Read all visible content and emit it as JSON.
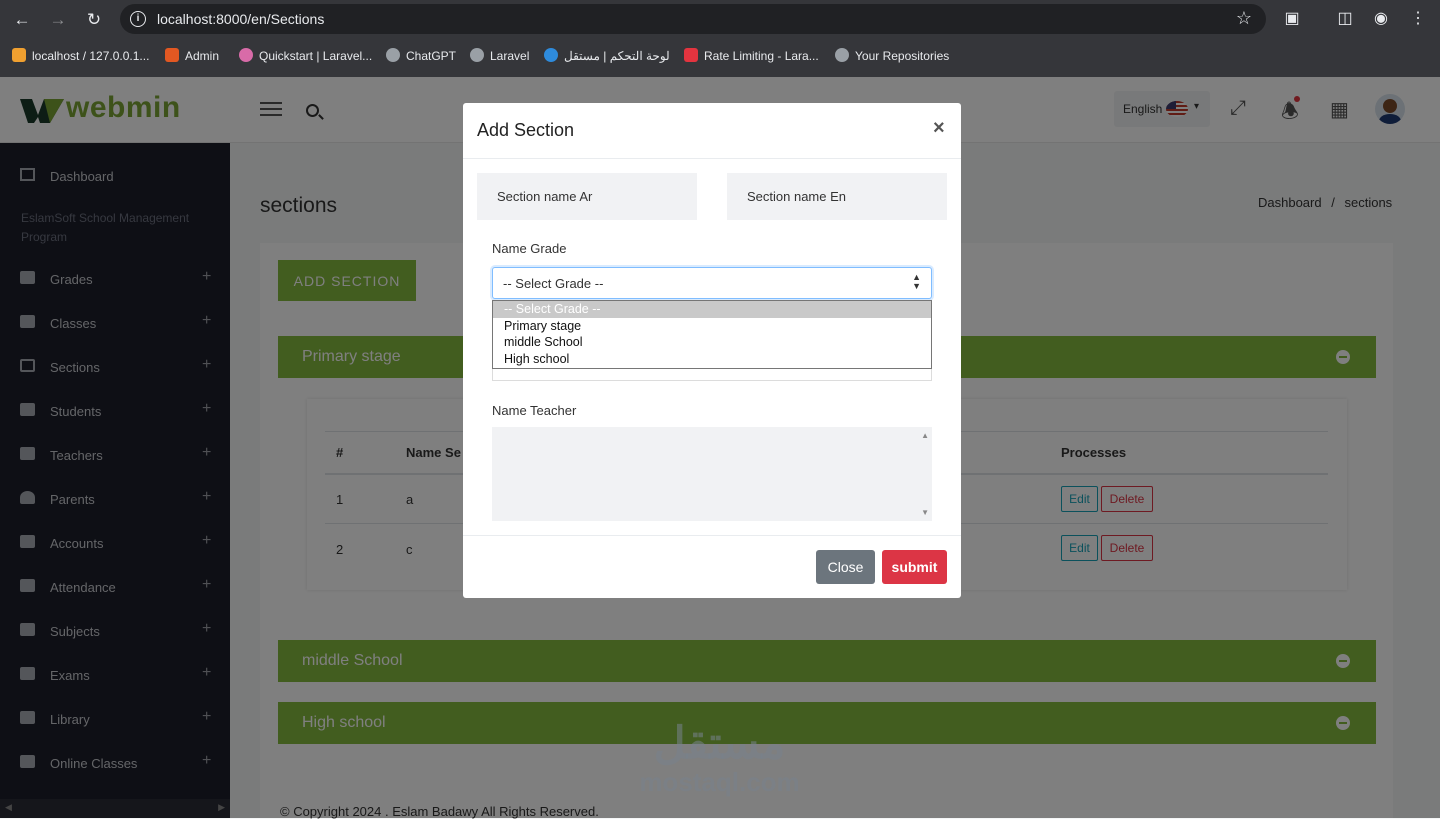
{
  "browser": {
    "url": "localhost:8000/en/Sections",
    "bookmarks": [
      {
        "label": "localhost / 127.0.0.1...",
        "color": "#f0a030"
      },
      {
        "label": "Admin",
        "color": "#e25822"
      },
      {
        "label": "Quickstart | Laravel...",
        "color": "#d86ba8"
      },
      {
        "label": "ChatGPT",
        "color": "#9aa0a6"
      },
      {
        "label": "Laravel",
        "color": "#9aa0a6"
      },
      {
        "label": "لوحة التحكم | مستقل",
        "color": "#2e8bdc"
      },
      {
        "label": "Rate Limiting - Lara...",
        "color": "#e3343f"
      },
      {
        "label": "Your Repositories",
        "color": "#9aa0a6"
      }
    ]
  },
  "header": {
    "logo": "webmin",
    "language": "English"
  },
  "sidebar": {
    "dashboard": "Dashboard",
    "note": "EslamSoft School Management Program",
    "items": [
      {
        "label": "Grades"
      },
      {
        "label": "Classes"
      },
      {
        "label": "Sections"
      },
      {
        "label": "Students"
      },
      {
        "label": "Teachers"
      },
      {
        "label": "Parents"
      },
      {
        "label": "Accounts"
      },
      {
        "label": "Attendance"
      },
      {
        "label": "Subjects"
      },
      {
        "label": "Exams"
      },
      {
        "label": "Library"
      },
      {
        "label": "Online Classes"
      }
    ]
  },
  "main": {
    "title": "sections",
    "breadcrumb": {
      "home": "Dashboard",
      "separator": "/",
      "current": "sections"
    },
    "add_button": "ADD SECTION",
    "accordions": [
      "Primary stage",
      "middle School",
      "High school"
    ],
    "table": {
      "headers": {
        "num": "#",
        "name": "Name Se",
        "processes": "Processes"
      },
      "rows": [
        {
          "num": "1",
          "name": "a"
        },
        {
          "num": "2",
          "name": "c"
        }
      ],
      "edit_label": "Edit",
      "delete_label": "Delete"
    },
    "footer": "© Copyright 2024 . Eslam Badawy All Rights Reserved."
  },
  "watermark": {
    "arabic": "مستقل",
    "english": "mostaql.com"
  },
  "modal": {
    "title": "Add Section",
    "close_x": "×",
    "name_ar_placeholder": "Section name Ar",
    "name_en_placeholder": "Section name En",
    "grade_label": "Name Grade",
    "grade_selected": "-- Select Grade --",
    "grade_options": [
      "-- Select Grade --",
      "Primary stage",
      "middle School",
      "High school"
    ],
    "teacher_label": "Name Teacher",
    "close_button": "Close",
    "submit_button": "submit"
  },
  "colors": {
    "brand_green": "#84ba3f",
    "sidebar_bg": "#1d1f2a",
    "submit_red": "#dc3545",
    "close_grey": "#6c757d"
  }
}
